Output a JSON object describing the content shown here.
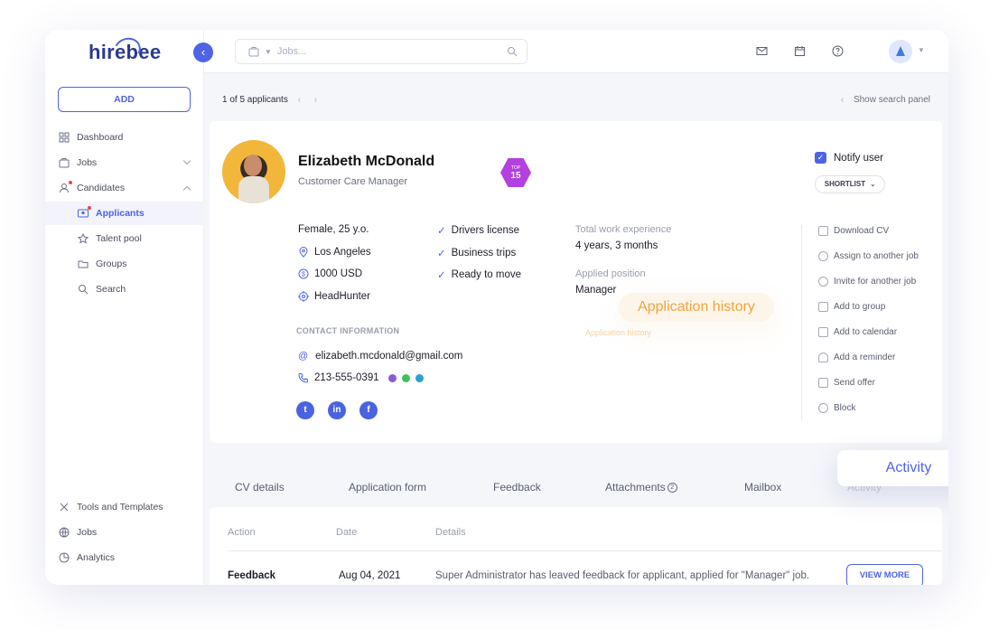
{
  "app": {
    "logo": "hirebee",
    "collapse_icon": "chevron-left-icon"
  },
  "sidebar": {
    "add_label": "ADD",
    "items": [
      {
        "label": "Dashboard",
        "icon": "grid-icon"
      },
      {
        "label": "Jobs",
        "icon": "briefcase-icon"
      },
      {
        "label": "Candidates",
        "icon": "user-icon"
      },
      {
        "label": "Applicants",
        "icon": "id-card-icon"
      },
      {
        "label": "Talent pool",
        "icon": "star-icon"
      },
      {
        "label": "Groups",
        "icon": "folder-icon"
      },
      {
        "label": "Search",
        "icon": "search-icon"
      }
    ],
    "bottom_items": [
      {
        "label": "Tools and Templates",
        "icon": "tools-icon"
      },
      {
        "label": "Jobs",
        "icon": "globe-icon"
      },
      {
        "label": "Analytics",
        "icon": "pie-chart-icon"
      }
    ]
  },
  "topbar": {
    "search_placeholder": "Jobs..."
  },
  "crumb": {
    "position": "1 of 5 applicants",
    "show_search": "Show search panel"
  },
  "candidate": {
    "name": "Elizabeth McDonald",
    "role": "Customer Care Manager",
    "badge_top": "TOP",
    "badge_num": "15",
    "notify_label": "Notify user",
    "shortlist_label": "SHORTLIST",
    "gender_age": "Female, 25 y.o.",
    "location": "Los Angeles",
    "salary": "1000 USD",
    "source": "HeadHunter",
    "checks": [
      "Drivers license",
      "Business trips",
      "Ready to move"
    ],
    "experience_label": "Total work experience",
    "experience_value": "4 years, 3 months",
    "position_label": "Applied position",
    "position_value": "Manager",
    "contact_heading": "CONTACT INFORMATION",
    "email": "elizabeth.mcdonald@gmail.com",
    "phone": "213-555-0391",
    "social": [
      "twitter-icon",
      "linkedin-icon",
      "facebook-icon"
    ]
  },
  "actions": [
    "Download CV",
    "Assign to another job",
    "Invite for another job",
    "Add to group",
    "Add to calendar",
    "Add a reminder",
    "Send offer",
    "Block"
  ],
  "overlay": {
    "app_history": "Application history",
    "app_history_small": "Application history",
    "activity": "Activity"
  },
  "tabs": [
    {
      "label": "CV details"
    },
    {
      "label": "Application form"
    },
    {
      "label": "Feedback"
    },
    {
      "label": "Attachments",
      "count": "2"
    },
    {
      "label": "Mailbox"
    },
    {
      "label": "Activity"
    }
  ],
  "table": {
    "headers": [
      "Action",
      "Date",
      "Details"
    ],
    "row": {
      "action": "Feedback",
      "date": "Aug 04, 2021",
      "details": "Super Administrator has leaved feedback for applicant, applied for \"Manager\" job.",
      "button": "VIEW MORE"
    }
  }
}
